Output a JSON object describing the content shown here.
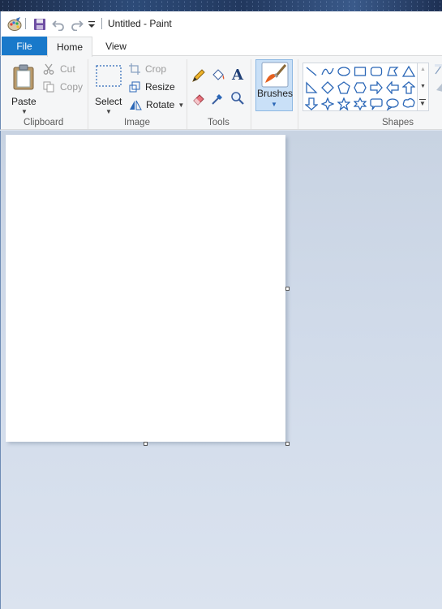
{
  "window": {
    "title": "Untitled - Paint"
  },
  "quick_access": {
    "app_icon": "paint-palette-icon",
    "save_icon": "save-icon",
    "undo_icon": "undo-icon",
    "redo_icon": "redo-icon",
    "customize_icon": "chevron-down-icon"
  },
  "tabs": [
    {
      "label": "File",
      "active": false
    },
    {
      "label": "Home",
      "active": true
    },
    {
      "label": "View",
      "active": false
    }
  ],
  "ribbon": {
    "clipboard": {
      "group_label": "Clipboard",
      "paste_label": "Paste",
      "cut_label": "Cut",
      "copy_label": "Copy"
    },
    "image": {
      "group_label": "Image",
      "select_label": "Select",
      "crop_label": "Crop",
      "resize_label": "Resize",
      "rotate_label": "Rotate"
    },
    "tools": {
      "group_label": "Tools",
      "items": [
        "pencil-icon",
        "fill-bucket-icon",
        "text-icon",
        "eraser-icon",
        "color-picker-icon",
        "magnifier-icon"
      ]
    },
    "brushes": {
      "label": "Brushes"
    },
    "shapes": {
      "group_label": "Shapes",
      "items": [
        "line",
        "curve",
        "oval",
        "rectangle",
        "rounded-rectangle",
        "polygon",
        "triangle",
        "right-triangle",
        "diamond",
        "pentagon",
        "hexagon",
        "right-arrow",
        "left-arrow",
        "up-arrow",
        "down-arrow",
        "four-point-star",
        "five-point-star",
        "six-point-star",
        "rounded-callout",
        "oval-callout",
        "cloud-callout"
      ]
    }
  },
  "colors": {
    "file_tab": "#1979ca",
    "ribbon_bg": "#f5f6f7",
    "selected_button": "#c9e0f7",
    "canvas_bg": "#ffffff",
    "workspace_bg": "#d1dbea"
  }
}
